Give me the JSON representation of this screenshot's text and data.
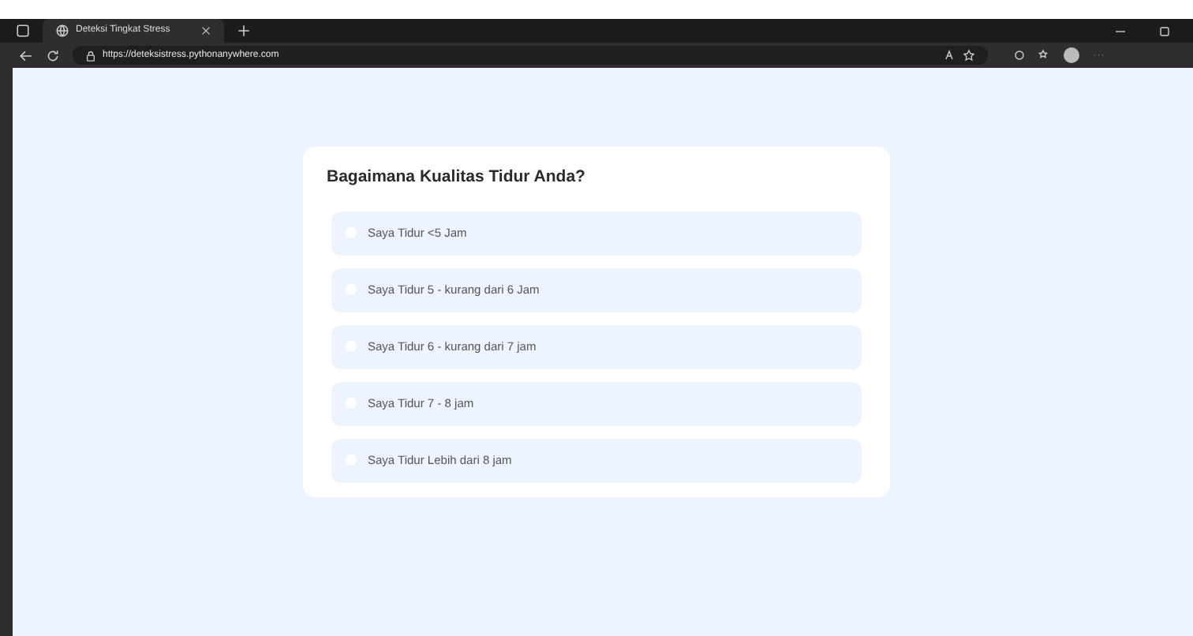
{
  "browser": {
    "tab_title": "Deteksi Tingkat Stress",
    "url": "https://deteksistress.pythonanywhere.com"
  },
  "question": {
    "title": "Bagaimana Kualitas Tidur Anda?",
    "options": [
      {
        "label": "Saya Tidur <5 Jam",
        "selected": false
      },
      {
        "label": "Saya Tidur 5 - kurang dari 6 Jam",
        "selected": false
      },
      {
        "label": "Saya Tidur 6 - kurang dari 7 jam",
        "selected": false
      },
      {
        "label": "Saya Tidur 7 - 8 jam",
        "selected": false
      },
      {
        "label": "Saya Tidur Lebih dari 8 jam",
        "selected": false
      }
    ]
  }
}
